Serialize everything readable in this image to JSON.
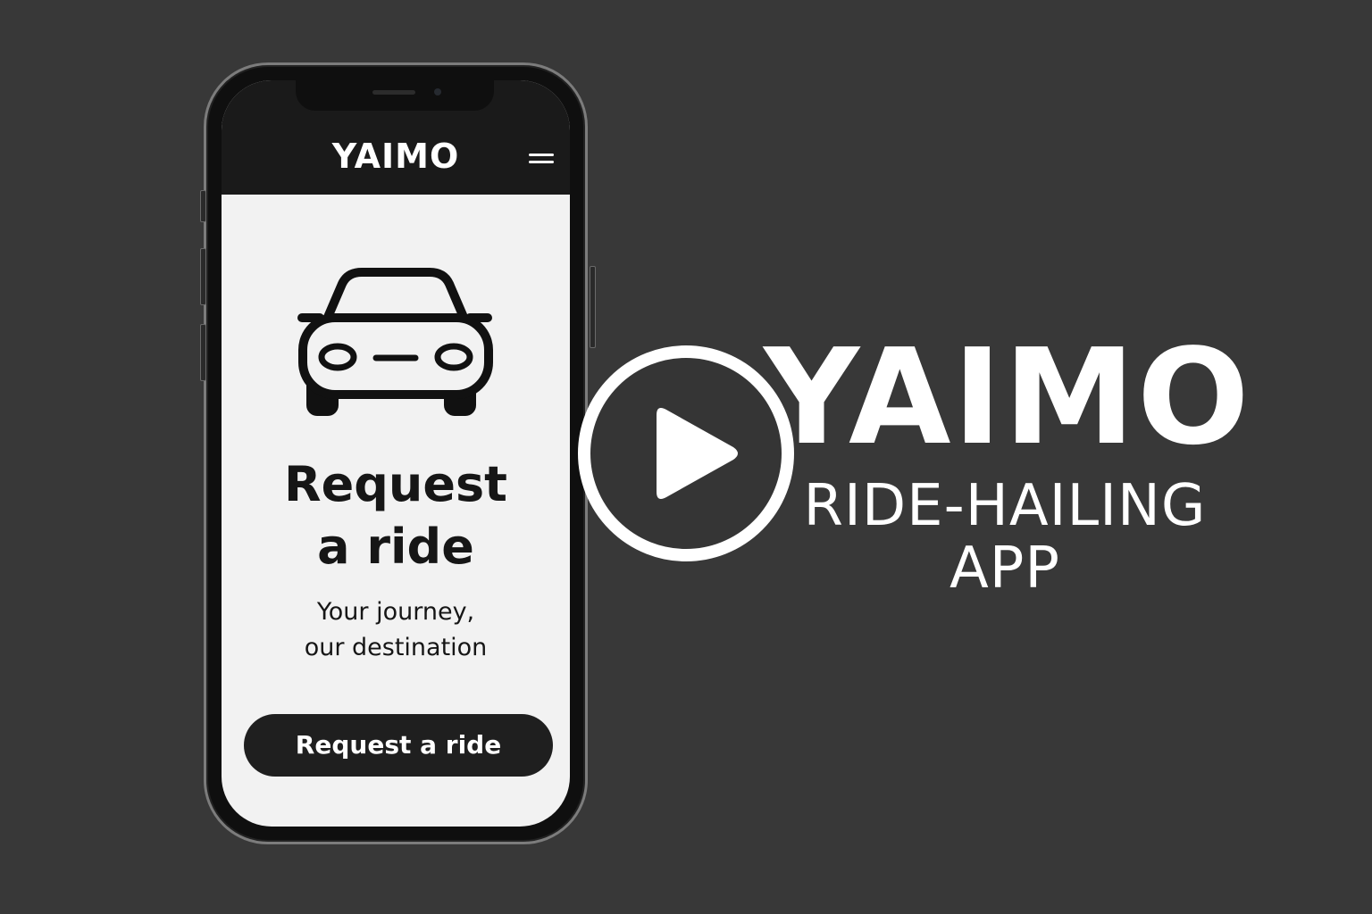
{
  "phone": {
    "header": {
      "title": "YAIMO",
      "menu_icon": "hamburger-menu-icon"
    },
    "hero_icon": "car-icon",
    "headline_line1": "Request",
    "headline_line2": "a ride",
    "tagline_line1": "Your journey,",
    "tagline_line2": "our destination",
    "cta_label": "Request a ride"
  },
  "play_icon": "play-icon",
  "brand": {
    "title": "YAIMO",
    "subtitle_line1": "RIDE-HAILING",
    "subtitle_line2": "APP"
  },
  "colors": {
    "background": "#383838",
    "screen": "#f2f2f2",
    "header": "#1a1a1a",
    "button": "#1f1f1f",
    "text_light": "#ffffff",
    "text_dark": "#161616"
  }
}
